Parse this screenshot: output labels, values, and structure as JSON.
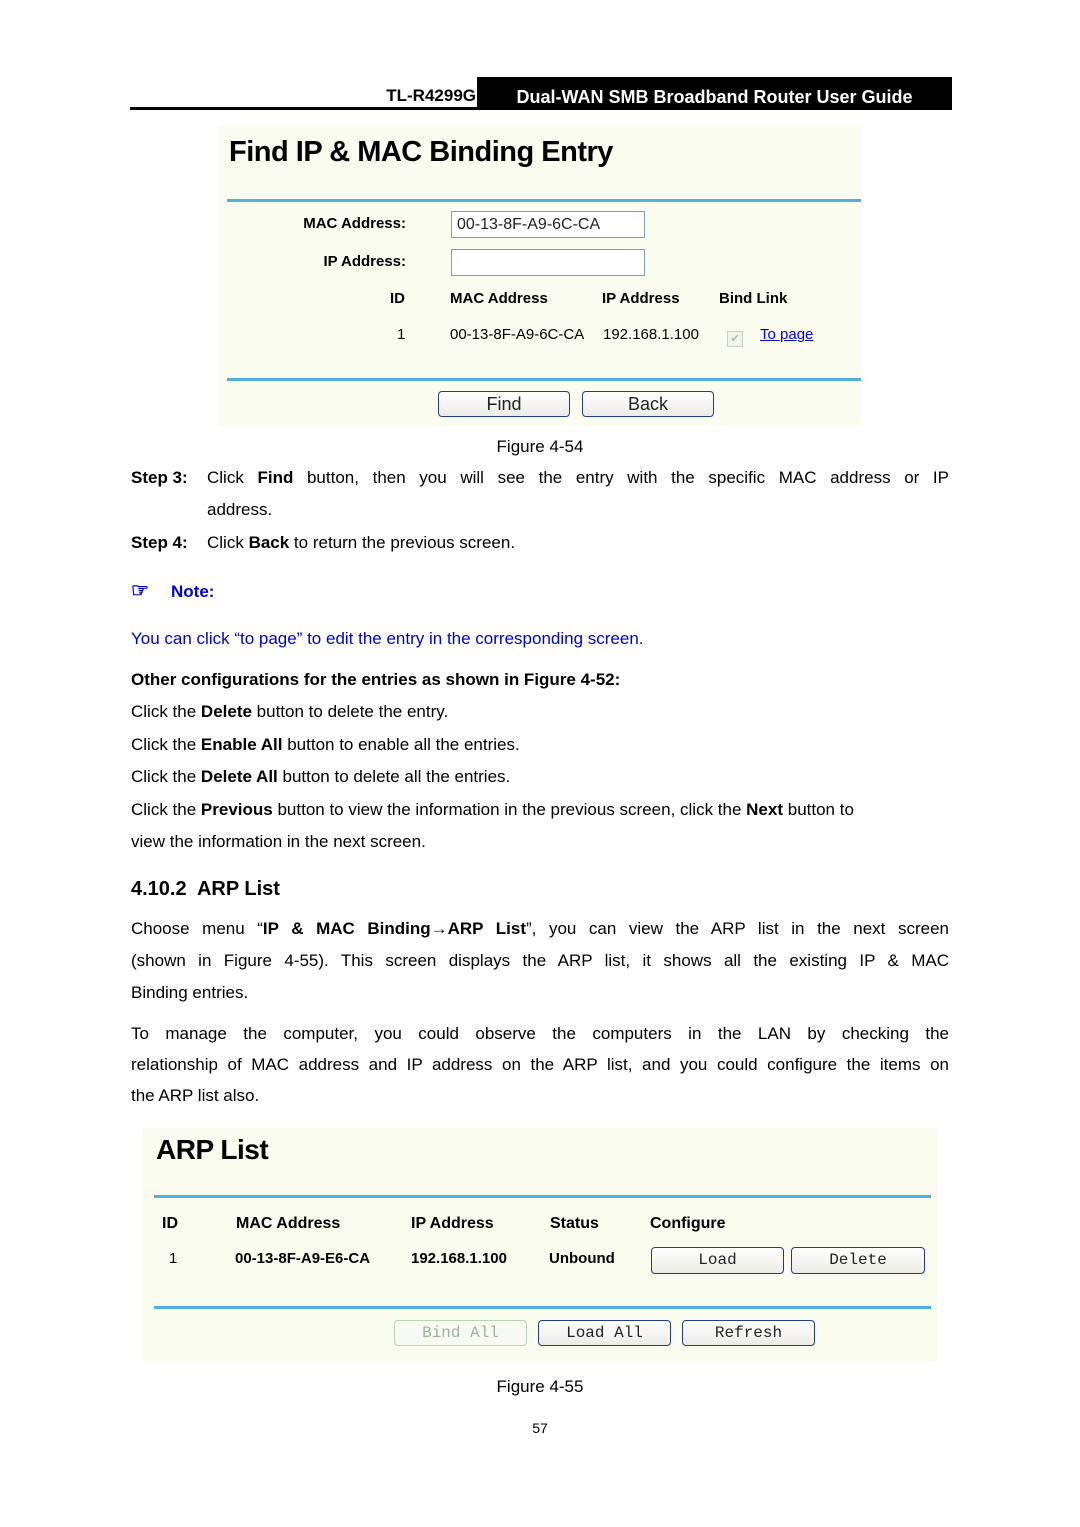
{
  "header": {
    "model": "TL-R4299G",
    "guide_title": "Dual-WAN SMB Broadband Router User Guide"
  },
  "figure54": {
    "title": "Find IP & MAC Binding Entry",
    "mac_label": "MAC Address:",
    "mac_value": "00-13-8F-A9-6C-CA",
    "ip_label": "IP Address:",
    "ip_value": "",
    "table": {
      "headers": [
        "ID",
        "MAC Address",
        "IP Address",
        "Bind Link"
      ],
      "rows": [
        {
          "id": "1",
          "mac": "00-13-8F-A9-6C-CA",
          "ip": "192.168.1.100",
          "bind_checked": true,
          "link": "To page"
        }
      ]
    },
    "buttons": {
      "find": "Find",
      "back": "Back"
    },
    "caption": "Figure 4-54"
  },
  "steps": [
    {
      "label": "Step 3:",
      "pre": "Click ",
      "bold": "Find",
      "post_line1": " button, then you will see the entry with the specific MAC address or IP",
      "post_line2": "address."
    },
    {
      "label": "Step 4:",
      "pre": "Click ",
      "bold": "Back",
      "post": " to return the previous screen."
    }
  ],
  "note": {
    "icon": "pointing-hand-icon",
    "label": "Note:",
    "text": "You can click “to page” to edit the entry in the corresponding screen.",
    "color": "#0000cc"
  },
  "other_config": {
    "heading": "Other configurations for the entries as shown in Figure 4-52:",
    "lines": [
      {
        "pre": "Click the ",
        "bold": "Delete",
        "post": " button to delete the entry."
      },
      {
        "pre": "Click the ",
        "bold": "Enable All",
        "post": " button to enable all the entries."
      },
      {
        "pre": "Click the ",
        "bold": "Delete All",
        "post": " button to delete all the entries."
      }
    ],
    "last": {
      "pre": "Click the ",
      "bold1": "Previous",
      "mid": " button to view the information in the previous screen, click the ",
      "bold2": "Next",
      "post": " button to",
      "line2": "view the information in the next screen."
    }
  },
  "section": {
    "heading": "4.10.2  ARP List",
    "para1": {
      "pre": "Choose menu “",
      "bold": "IP & MAC Binding→ARP List",
      "post_line1": "”, you can view the ARP list in the next screen",
      "line2": "(shown in Figure 4-55). This screen displays the ARP list, it shows all the existing IP & MAC",
      "line3": "Binding entries."
    },
    "para2": {
      "line1": "To manage the computer, you could observe the computers in the LAN by checking the",
      "line2": "relationship of MAC address and IP address on the ARP list, and you could configure the items on",
      "line3": "the ARP list also."
    }
  },
  "figure55": {
    "title": "ARP List",
    "table": {
      "headers": [
        "ID",
        "MAC Address",
        "IP Address",
        "Status",
        "Configure"
      ],
      "rows": [
        {
          "id": "1",
          "mac": "00-13-8F-A9-E6-CA",
          "ip": "192.168.1.100",
          "status": "Unbound",
          "load": "Load",
          "delete": "Delete"
        }
      ]
    },
    "buttons": {
      "bind_all": "Bind All",
      "load_all": "Load All",
      "refresh": "Refresh"
    },
    "caption": "Figure 4-55"
  },
  "page_number": "57"
}
